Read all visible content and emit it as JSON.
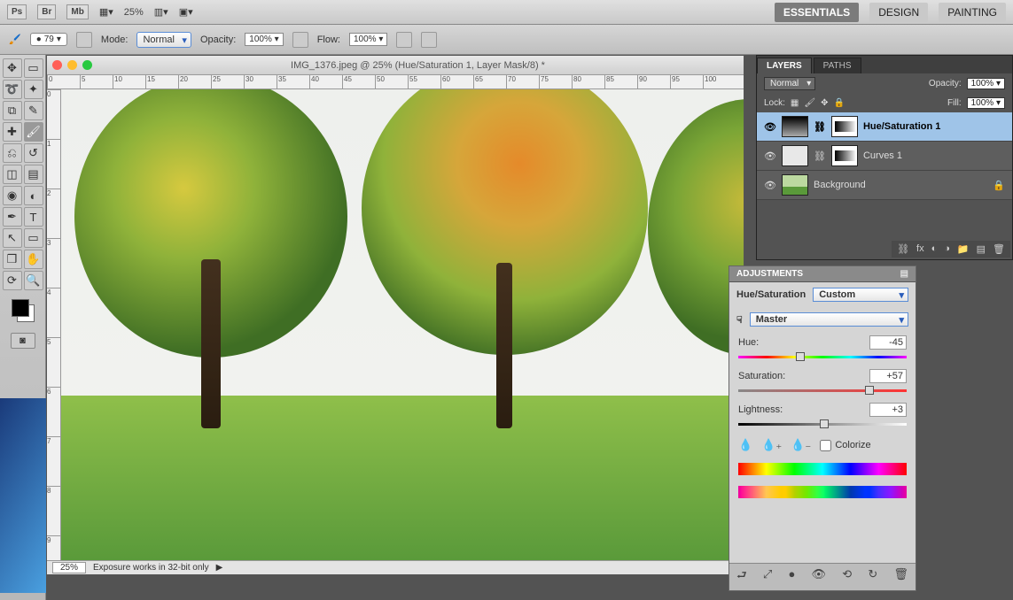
{
  "menubar": {
    "app": "Ps",
    "icons": [
      "Br",
      "Mb"
    ],
    "zoom": "25%",
    "workspaces": [
      {
        "label": "ESSENTIALS",
        "active": true
      },
      {
        "label": "DESIGN",
        "active": false
      },
      {
        "label": "PAINTING",
        "active": false
      }
    ]
  },
  "optbar": {
    "brush_size": "79",
    "mode_label": "Mode:",
    "mode_value": "Normal",
    "opacity_label": "Opacity:",
    "opacity_value": "100%",
    "flow_label": "Flow:",
    "flow_value": "100%"
  },
  "document": {
    "title": "IMG_1376.jpeg @ 25% (Hue/Saturation 1, Layer Mask/8) *",
    "ruler_ticks_h": [
      "0",
      "5",
      "10",
      "15",
      "20",
      "25",
      "30",
      "35",
      "40",
      "45",
      "50",
      "55",
      "60",
      "65",
      "70",
      "75",
      "80",
      "85",
      "90",
      "95",
      "100"
    ],
    "ruler_ticks_v": [
      "0",
      "1",
      "2",
      "3",
      "4",
      "5",
      "6",
      "7",
      "8",
      "9"
    ],
    "status_zoom": "25%",
    "status_text": "Exposure works in 32-bit only"
  },
  "layers_panel": {
    "tabs": [
      "LAYERS",
      "PATHS"
    ],
    "active_tab": 0,
    "blend_mode": "Normal",
    "opacity_label": "Opacity:",
    "opacity_value": "100%",
    "lock_label": "Lock:",
    "fill_label": "Fill:",
    "fill_value": "100%",
    "layers": [
      {
        "name": "Hue/Saturation 1",
        "type": "adj",
        "active": true,
        "locked": false
      },
      {
        "name": "Curves 1",
        "type": "adj",
        "active": false,
        "locked": false
      },
      {
        "name": "Background",
        "type": "img",
        "active": false,
        "locked": true
      }
    ]
  },
  "adjustments": {
    "panel_label": "ADJUSTMENTS",
    "title": "Hue/Saturation",
    "preset": "Custom",
    "channel": "Master",
    "hue_label": "Hue:",
    "hue_value": "-45",
    "sat_label": "Saturation:",
    "sat_value": "+57",
    "lit_label": "Lightness:",
    "lit_value": "+3",
    "colorize_label": "Colorize"
  }
}
